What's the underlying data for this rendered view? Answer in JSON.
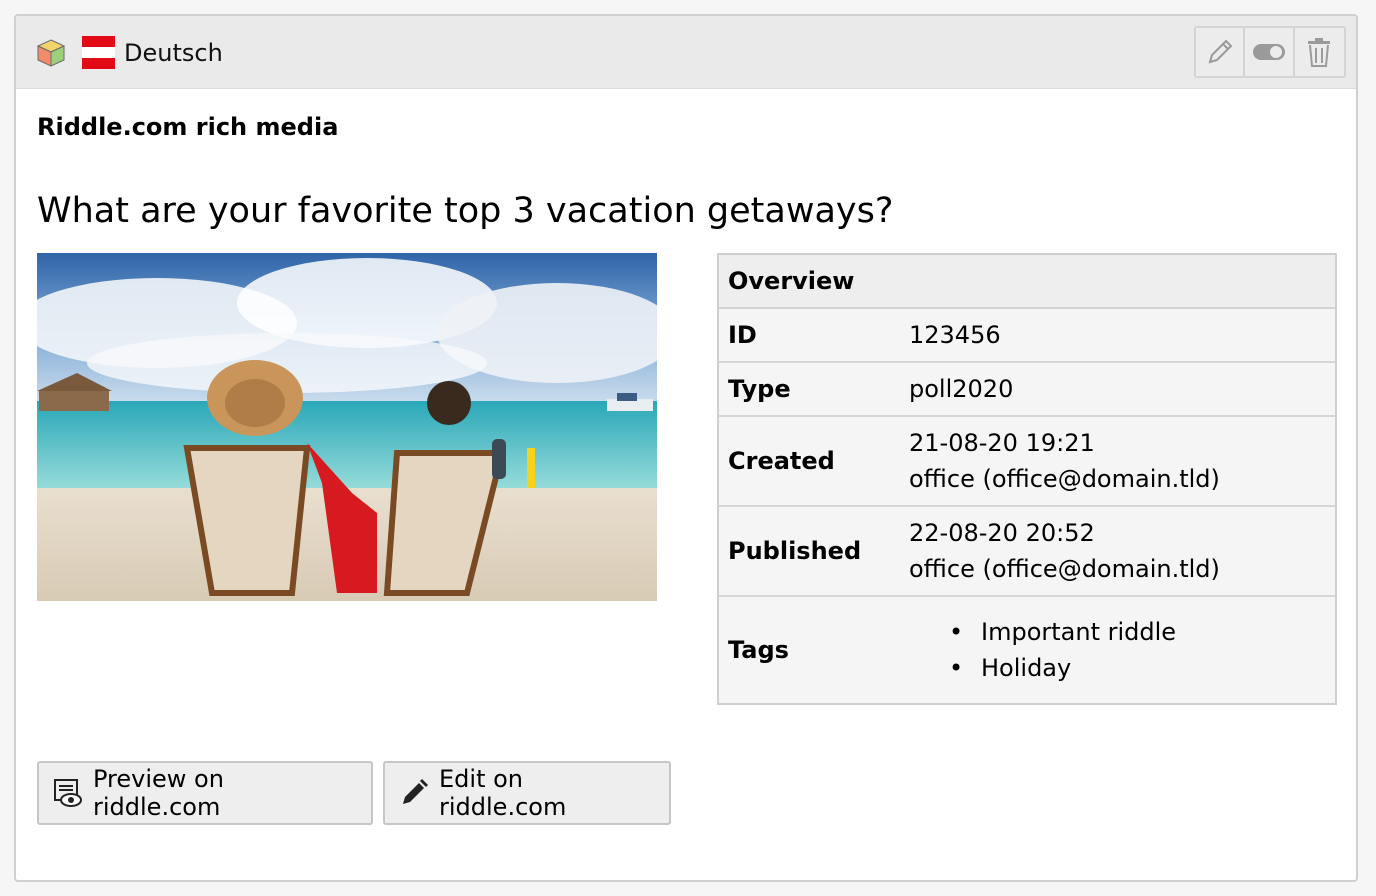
{
  "header": {
    "language_label": "Deutsch",
    "icons": {
      "content_type": "cube-icon",
      "flag": "austria-flag-icon",
      "edit": "pencil-icon",
      "toggle": "toggle-icon",
      "delete": "trash-icon"
    }
  },
  "content": {
    "type_label": "Riddle.com rich media",
    "question": "What are your favorite top 3 vacation getaways?"
  },
  "overview": {
    "title": "Overview",
    "rows": {
      "id": {
        "label": "ID",
        "value": "123456"
      },
      "type": {
        "label": "Type",
        "value": "poll2020"
      },
      "created": {
        "label": "Created",
        "date": "21-08-20 19:21",
        "user": "office (office@domain.tld)"
      },
      "published": {
        "label": "Published",
        "date": "22-08-20 20:52",
        "user": "office (office@domain.tld)"
      },
      "tags": {
        "label": "Tags",
        "items": [
          "Important riddle",
          "Holiday"
        ]
      }
    }
  },
  "buttons": {
    "preview": "Preview on riddle.com",
    "edit": "Edit on riddle.com"
  },
  "colors": {
    "flag_red": "#e20a16",
    "header_bg": "#eaeaea",
    "accent_bag": "#d71920"
  }
}
